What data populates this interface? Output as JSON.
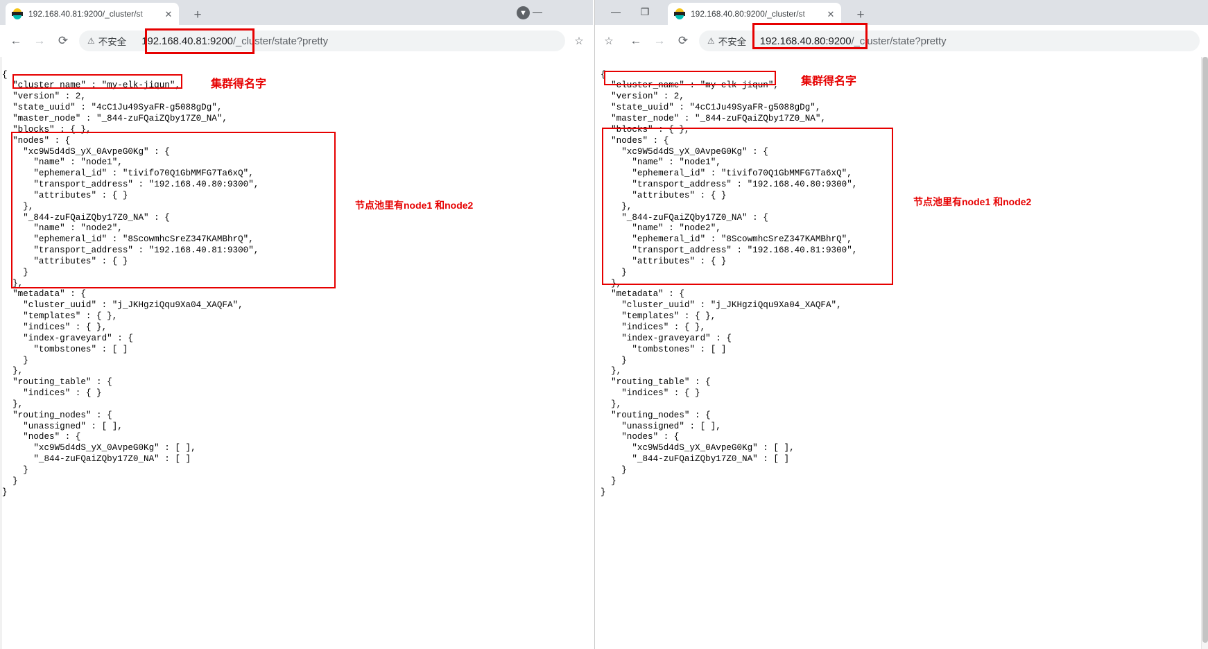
{
  "windows": [
    {
      "id": "left",
      "tab": {
        "title": "192.168.40.81:9200/_cluster/st",
        "favicon": "elasticsearch-icon",
        "close_label": "✕",
        "newtab_label": "+"
      },
      "window_controls": {
        "minimize": "—"
      },
      "profile_badge": "▼",
      "toolbar": {
        "back": "←",
        "forward": "→",
        "reload": "⟳",
        "warning_icon": "⚠",
        "warning_text": "不安全",
        "url_host": "192.168.40.81:9200",
        "url_path": "/_cluster/state?pretty",
        "star": "☆"
      },
      "content": "{\n  \"cluster_name\" : \"my-elk-jiqun\",\n  \"version\" : 2,\n  \"state_uuid\" : \"4cC1Ju49SyaFR-g5088gDg\",\n  \"master_node\" : \"_844-zuFQaiZQby17Z0_NA\",\n  \"blocks\" : { },\n  \"nodes\" : {\n    \"xc9W5d4dS_yX_0AvpeG0Kg\" : {\n      \"name\" : \"node1\",\n      \"ephemeral_id\" : \"tivifo70Q1GbMMFG7Ta6xQ\",\n      \"transport_address\" : \"192.168.40.80:9300\",\n      \"attributes\" : { }\n    },\n    \"_844-zuFQaiZQby17Z0_NA\" : {\n      \"name\" : \"node2\",\n      \"ephemeral_id\" : \"8ScowmhcSreZ347KAMBhrQ\",\n      \"transport_address\" : \"192.168.40.81:9300\",\n      \"attributes\" : { }\n    }\n  },\n  \"metadata\" : {\n    \"cluster_uuid\" : \"j_JKHgziQqu9Xa04_XAQFA\",\n    \"templates\" : { },\n    \"indices\" : { },\n    \"index-graveyard\" : {\n      \"tombstones\" : [ ]\n    }\n  },\n  \"routing_table\" : {\n    \"indices\" : { }\n  },\n  \"routing_nodes\" : {\n    \"unassigned\" : [ ],\n    \"nodes\" : {\n      \"xc9W5d4dS_yX_0AvpeG0Kg\" : [ ],\n      \"_844-zuFQaiZQby17Z0_NA\" : [ ]\n    }\n  }\n}",
      "annotations": {
        "cluster_name_label": "集群得名字",
        "nodes_label": "节点池里有node1  和node2"
      }
    },
    {
      "id": "right",
      "tab": {
        "title": "192.168.40.80:9200/_cluster/st",
        "favicon": "elasticsearch-icon",
        "close_label": "✕",
        "newtab_label": "+"
      },
      "window_controls": {
        "minimize": "—",
        "maximize": "❐"
      },
      "toolbar": {
        "back": "←",
        "forward": "→",
        "reload": "⟳",
        "warning_icon": "⚠",
        "warning_text": "不安全",
        "url_separator": "|",
        "url_host": "192.168.40.80:9200",
        "url_path": "/_cluster/state?pretty",
        "star": "☆"
      },
      "content": "{\n  \"cluster_name\" : \"my-elk-jiqun\",\n  \"version\" : 2,\n  \"state_uuid\" : \"4cC1Ju49SyaFR-g5088gDg\",\n  \"master_node\" : \"_844-zuFQaiZQby17Z0_NA\",\n  \"blocks\" : { },\n  \"nodes\" : {\n    \"xc9W5d4dS_yX_0AvpeG0Kg\" : {\n      \"name\" : \"node1\",\n      \"ephemeral_id\" : \"tivifo70Q1GbMMFG7Ta6xQ\",\n      \"transport_address\" : \"192.168.40.80:9300\",\n      \"attributes\" : { }\n    },\n    \"_844-zuFQaiZQby17Z0_NA\" : {\n      \"name\" : \"node2\",\n      \"ephemeral_id\" : \"8ScowmhcSreZ347KAMBhrQ\",\n      \"transport_address\" : \"192.168.40.81:9300\",\n      \"attributes\" : { }\n    }\n  },\n  \"metadata\" : {\n    \"cluster_uuid\" : \"j_JKHgziQqu9Xa04_XAQFA\",\n    \"templates\" : { },\n    \"indices\" : { },\n    \"index-graveyard\" : {\n      \"tombstones\" : [ ]\n    }\n  },\n  \"routing_table\" : {\n    \"indices\" : { }\n  },\n  \"routing_nodes\" : {\n    \"unassigned\" : [ ],\n    \"nodes\" : {\n      \"xc9W5d4dS_yX_0AvpeG0Kg\" : [ ],\n      \"_844-zuFQaiZQby17Z0_NA\" : [ ]\n    }\n  }\n}",
      "annotations": {
        "cluster_name_label": "集群得名字",
        "nodes_label": "节点池里有node1  和node2"
      }
    }
  ],
  "colors": {
    "annotation_red": "#e60000",
    "tabstrip_bg": "#dee1e6",
    "omnibox_bg": "#f1f3f4"
  }
}
